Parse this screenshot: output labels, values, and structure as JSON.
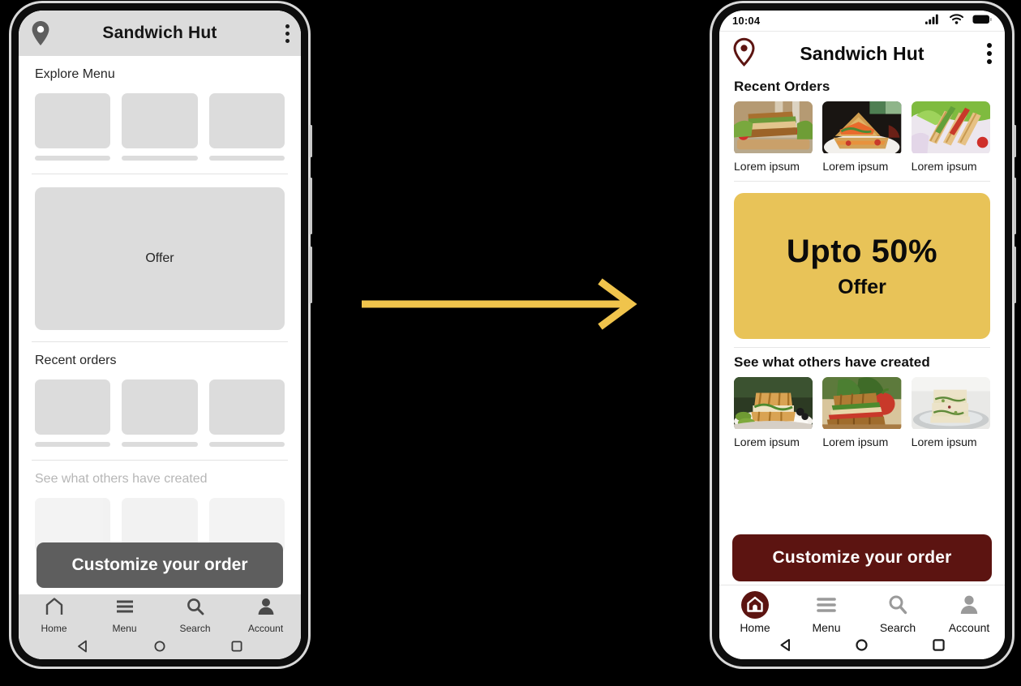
{
  "colors": {
    "brand_maroon": "#5C1411",
    "offer_yellow": "#E8C358",
    "arrow_yellow": "#F0C44C",
    "wireframe_gray": "#DCDCDC",
    "wireframe_button_gray": "#5E5E5E",
    "page_background": "#000000"
  },
  "arrow": {
    "name": "flow-arrow",
    "direction": "right"
  },
  "wireframe_phone": {
    "appbar": {
      "location_icon": "location-pin-icon",
      "title": "Sandwich Hut",
      "overflow_icon": "more-vertical-icon"
    },
    "sections": [
      {
        "title": "Explore Menu",
        "cards": [
          {
            "placeholder": true
          },
          {
            "placeholder": true
          },
          {
            "placeholder": true
          }
        ]
      },
      {
        "title": "Recent orders",
        "cards": [
          {
            "placeholder": true
          },
          {
            "placeholder": true
          },
          {
            "placeholder": true
          }
        ]
      },
      {
        "title": "See what others have created",
        "cards": [
          {
            "placeholder": true
          },
          {
            "placeholder": true
          },
          {
            "placeholder": true
          }
        ]
      }
    ],
    "offer_banner": {
      "label": "Offer"
    },
    "cta_button": {
      "label": "Customize your order"
    },
    "tabbar": {
      "items": [
        {
          "icon": "home-icon",
          "label": "Home",
          "active": false
        },
        {
          "icon": "menu-icon",
          "label": "Menu",
          "active": false
        },
        {
          "icon": "search-icon",
          "label": "Search",
          "active": false
        },
        {
          "icon": "account-icon",
          "label": "Account",
          "active": false
        }
      ]
    },
    "navbar": {
      "items": [
        {
          "icon": "android-back-icon"
        },
        {
          "icon": "android-home-icon"
        },
        {
          "icon": "android-recents-icon"
        }
      ]
    }
  },
  "hifi_phone": {
    "statusbar": {
      "time": "10:04",
      "icons": [
        "cellular-signal-icon",
        "wifi-icon",
        "battery-icon"
      ]
    },
    "appbar": {
      "location_icon": "location-pin-icon",
      "title": "Sandwich Hut",
      "overflow_icon": "more-vertical-icon"
    },
    "recent_orders": {
      "title": "Recent Orders",
      "items": [
        {
          "caption": "Lorem ipsum",
          "image": "veggie-sandwich-photo"
        },
        {
          "caption": "Lorem ipsum",
          "image": "grilled-toast-sandwich-photo"
        },
        {
          "caption": "Lorem ipsum",
          "image": "club-sandwich-photo"
        }
      ]
    },
    "offer_banner": {
      "headline": "Upto 50%",
      "subline": "Offer"
    },
    "community": {
      "title": "See what others have created",
      "items": [
        {
          "caption": "Lorem ipsum",
          "image": "panini-sandwich-photo"
        },
        {
          "caption": "Lorem ipsum",
          "image": "turkey-sandwich-photo"
        },
        {
          "caption": "Lorem ipsum",
          "image": "egg-salad-sandwich-photo"
        }
      ]
    },
    "cta_button": {
      "label": "Customize your order"
    },
    "tabbar": {
      "items": [
        {
          "icon": "home-icon",
          "label": "Home",
          "active": true
        },
        {
          "icon": "menu-icon",
          "label": "Menu",
          "active": false
        },
        {
          "icon": "search-icon",
          "label": "Search",
          "active": false
        },
        {
          "icon": "account-icon",
          "label": "Account",
          "active": false
        }
      ]
    },
    "navbar": {
      "items": [
        {
          "icon": "android-back-icon"
        },
        {
          "icon": "android-home-icon"
        },
        {
          "icon": "android-recents-icon"
        }
      ]
    }
  }
}
